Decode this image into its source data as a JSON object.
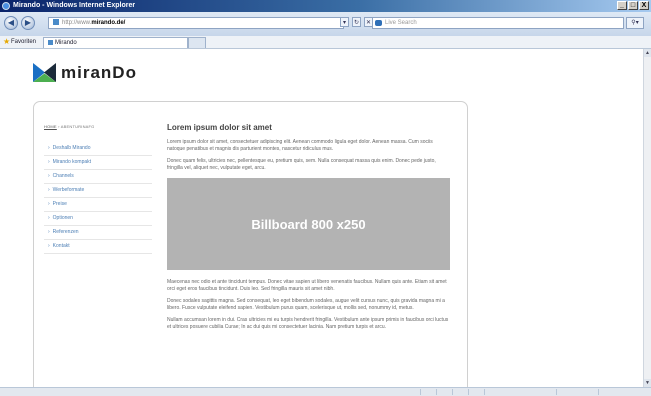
{
  "window": {
    "title": "Mirando - Windows Internet Explorer",
    "controls": {
      "minimize": "_",
      "maximize": "□",
      "close": "X"
    }
  },
  "browser": {
    "back_icon": "back-arrow-icon",
    "forward_icon": "forward-arrow-icon",
    "address": {
      "protocol": "http://www.",
      "domain": "mirando.de/"
    },
    "search_placeholder": "Live Search",
    "favorites_label": "Favoriten",
    "tab_title": "Mirando"
  },
  "site": {
    "logo_text": "miranDo",
    "logo_colors": {
      "blue": "#1a6fc4",
      "green": "#4caf50",
      "dark": "#1b2a3a"
    }
  },
  "breadcrumb": {
    "home": "HOME",
    "separator": " › ",
    "current": "ABENTURINAFG"
  },
  "sidebar": {
    "items": [
      {
        "label": "Deshalb Mirando"
      },
      {
        "label": "Mirando kompakt"
      },
      {
        "label": "Channels"
      },
      {
        "label": "Werbeformate"
      },
      {
        "label": "Preise"
      },
      {
        "label": "Optionen"
      },
      {
        "label": "Referenzen"
      },
      {
        "label": "Kontakt"
      }
    ]
  },
  "content": {
    "heading": "Lorem ipsum dolor sit amet",
    "p1": "Lorem ipsum dolor sit amet, consectetuer adipiscing elit. Aenean commodo ligula eget dolor. Aenean massa. Cum sociis natoque penatibus et magnis dis parturient montes, nascetur ridiculus mus.",
    "p2": "Donec quam felis, ultricies nec, pellentesque eu, pretium quis, sem. Nulla consequat massa quis enim. Donec pede justo, fringilla vel, aliquet nec, vulputate eget, arcu.",
    "billboard": "Billboard 800 x250",
    "p3": "Maecenas nec odio et ante tincidunt tempus. Donec vitae sapien ut libero venenatis faucibus. Nullam quis ante. Etiam sit amet orci eget eros faucibus tincidunt. Duis leo. Sed fringilla mauris sit amet nibh.",
    "p4": "Donec sodales sagittis magna. Sed consequat, leo eget bibendum sodales, augue velit cursus nunc, quis gravida magna mi a libero. Fusce vulputate eleifend sapien. Vestibulum purus quam, scelerisque ut, mollis sed, nonummy id, metus.",
    "p5": "Nullam accumsan lorem in dui. Cras ultricies mi eu turpis hendrerit fringilla. Vestibulum ante ipsum primis in faucibus orci luctus et ultrices posuere cubilia Curae; In ac dui quis mi consectetuer lacinia. Nam pretium turpis et arcu."
  }
}
